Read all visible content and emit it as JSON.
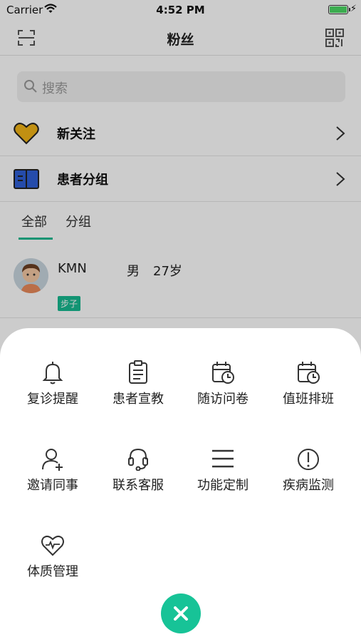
{
  "status_bar": {
    "carrier": "Carrier",
    "time": "4:52 PM"
  },
  "nav": {
    "title": "粉丝"
  },
  "search": {
    "placeholder": "搜索"
  },
  "rows": [
    {
      "label": "新关注",
      "icon": "heart-icon"
    },
    {
      "label": "患者分组",
      "icon": "book-icon"
    }
  ],
  "tabs": [
    {
      "label": "全部",
      "active": true
    },
    {
      "label": "分组",
      "active": false
    }
  ],
  "fans": [
    {
      "name": "KMN",
      "gender": "男",
      "age": "27岁",
      "tag": "步子"
    }
  ],
  "menu": {
    "items": [
      {
        "label": "复诊提醒",
        "icon": "bell-icon"
      },
      {
        "label": "患者宣教",
        "icon": "clipboard-icon"
      },
      {
        "label": "随访问卷",
        "icon": "calendar-clock-icon"
      },
      {
        "label": "值班排班",
        "icon": "calendar-clock-icon"
      },
      {
        "label": "邀请同事",
        "icon": "add-user-icon"
      },
      {
        "label": "联系客服",
        "icon": "headset-icon"
      },
      {
        "label": "功能定制",
        "icon": "menu-lines-icon"
      },
      {
        "label": "疾病监测",
        "icon": "alert-circle-icon"
      },
      {
        "label": "体质管理",
        "icon": "heart-pulse-icon"
      }
    ]
  },
  "colors": {
    "accent": "#17c397"
  }
}
